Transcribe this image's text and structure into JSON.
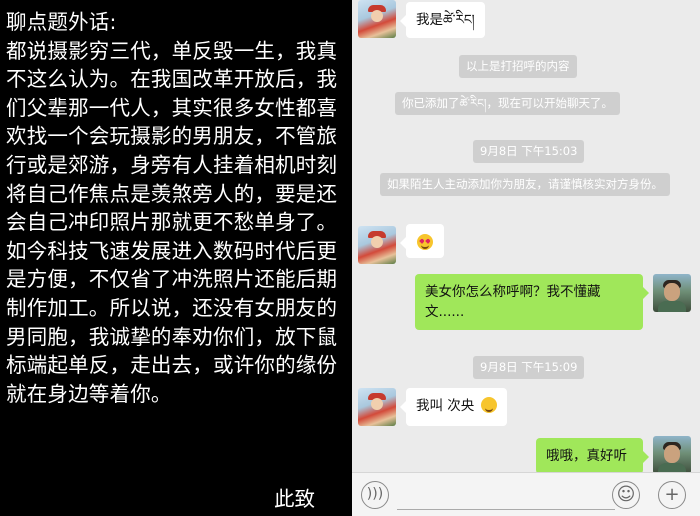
{
  "essay": {
    "text": "聊点题外话:\n都说摄影穷三代，单反毁一生，我真不这么认为。在我国改革开放后，我们父辈那一代人，其实很多女性都喜欢找一个会玩摄影的男朋友，不管旅行或是郊游，身旁有人挂着相机时刻将自己作焦点是羡煞旁人的，要是还会自己冲印照片那就更不愁单身了。如今科技飞速发展进入数码时代后更是方便，不仅省了冲洗照片还能后期制作加工。所以说，还没有女朋友的男同胞，我诚挚的奉劝你们，放下鼠标端起单反，走出去，或许你的缘份就在身边等着你。",
    "signature": "此致"
  },
  "chat": {
    "messages": [
      {
        "type": "received",
        "text": "我是ཚེ་རིང།"
      },
      {
        "type": "system",
        "text": "以上是打招呼的内容"
      },
      {
        "type": "system",
        "text": "你已添加了ཚེ་རིང།，现在可以开始聊天了。"
      },
      {
        "type": "time",
        "text": "9月8日 下午15:03"
      },
      {
        "type": "system",
        "text": "如果陌生人主动添加你为朋友，请谨慎核实对方身份。"
      },
      {
        "type": "received",
        "emoji": "heart-eyes-emoji"
      },
      {
        "type": "sent",
        "text": "美女你怎么称呼啊？我不懂藏文......"
      },
      {
        "type": "time",
        "text": "9月8日 下午15:09"
      },
      {
        "type": "received",
        "text": "我叫  次央"
      },
      {
        "type": "sent",
        "text": "哦哦，真好听"
      }
    ]
  },
  "input_bar": {
    "voice_icon": "voice-icon",
    "emoji_icon": "emoji-icon",
    "plus_icon": "plus-icon"
  },
  "colors": {
    "sent_bubble": "#a0e75a",
    "received_bubble": "#ffffff",
    "chat_bg": "#ebebeb",
    "system_bg": "#cfcfcf"
  }
}
